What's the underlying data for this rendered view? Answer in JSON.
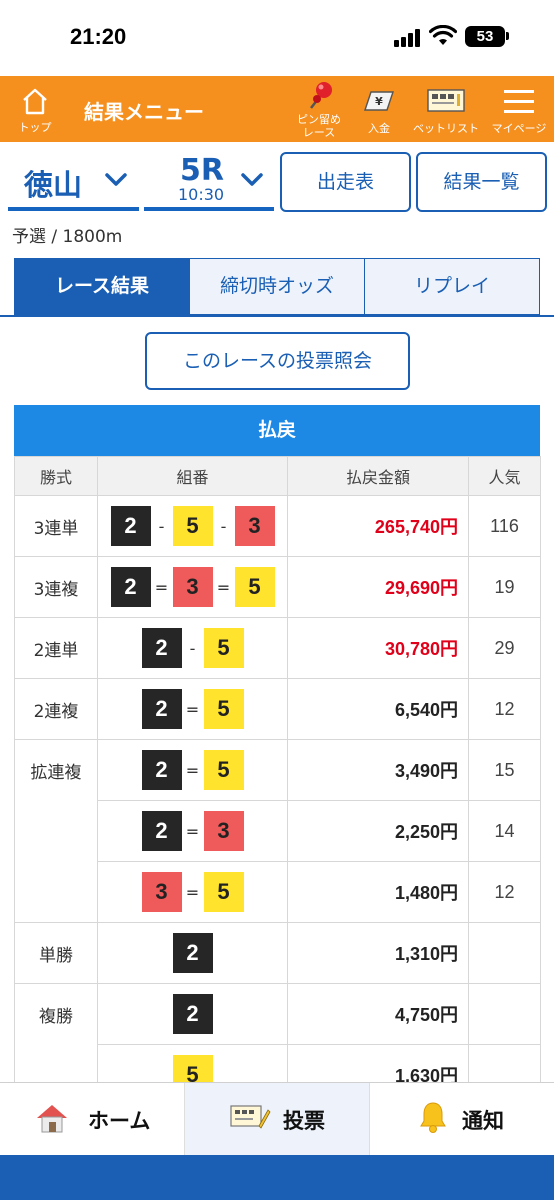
{
  "status_bar": {
    "time": "21:20",
    "battery": "53"
  },
  "header": {
    "home_label": "トップ",
    "title": "結果メニュー",
    "pin_label_line1": "ピン留め",
    "pin_label_line2": "レース",
    "deposit_label": "入金",
    "pets_label": "ベットリスト",
    "mypage_label": "マイページ"
  },
  "race": {
    "venue": "徳山",
    "number": "5R",
    "time": "10:30",
    "grade": "予選 / 1800m",
    "entry_button": "出走表",
    "results_list_button": "結果一覧"
  },
  "tabs": [
    {
      "label": "レース結果",
      "active": true
    },
    {
      "label": "締切時オッズ",
      "active": false
    },
    {
      "label": "リプレイ",
      "active": false
    }
  ],
  "vote_inquiry_button": "このレースの投票照会",
  "payout": {
    "title": "払戻",
    "headers": {
      "type": "勝式",
      "combo": "組番",
      "amount": "払戻金額",
      "popularity": "人気"
    },
    "rows": [
      {
        "type": "3連単",
        "boats": [
          "2",
          "5",
          "3"
        ],
        "seps": [
          "-",
          "-"
        ],
        "amount": "265,740円",
        "popularity": "116",
        "highlight": true
      },
      {
        "type": "3連複",
        "boats": [
          "2",
          "3",
          "5"
        ],
        "seps": [
          "=",
          "="
        ],
        "amount": "29,690円",
        "popularity": "19",
        "highlight": true
      },
      {
        "type": "2連単",
        "boats": [
          "2",
          "5"
        ],
        "seps": [
          "-"
        ],
        "amount": "30,780円",
        "popularity": "29",
        "highlight": true
      },
      {
        "type": "2連複",
        "boats": [
          "2",
          "5"
        ],
        "seps": [
          "="
        ],
        "amount": "6,540円",
        "popularity": "12",
        "highlight": false
      },
      {
        "type": "拡連複",
        "boats": [
          "2",
          "5"
        ],
        "seps": [
          "="
        ],
        "amount": "3,490円",
        "popularity": "15",
        "highlight": false
      },
      {
        "type": "",
        "boats": [
          "2",
          "3"
        ],
        "seps": [
          "="
        ],
        "amount": "2,250円",
        "popularity": "14",
        "highlight": false
      },
      {
        "type": "",
        "boats": [
          "3",
          "5"
        ],
        "seps": [
          "="
        ],
        "amount": "1,480円",
        "popularity": "12",
        "highlight": false
      },
      {
        "type": "単勝",
        "boats": [
          "2"
        ],
        "seps": [],
        "amount": "1,310円",
        "popularity": "",
        "highlight": false
      },
      {
        "type": "複勝",
        "boats": [
          "2"
        ],
        "seps": [],
        "amount": "4,750円",
        "popularity": "",
        "highlight": false
      },
      {
        "type": "",
        "boats": [
          "5"
        ],
        "seps": [],
        "amount": "1,630円",
        "popularity": "",
        "highlight": false
      }
    ]
  },
  "colors": {
    "accent": "#1a5fb4",
    "header": "#f5901f",
    "payout_red": "#e0001a"
  },
  "bottom_nav": [
    {
      "label": "ホーム",
      "icon": "house-icon"
    },
    {
      "label": "投票",
      "icon": "betting-slip-icon",
      "active": true
    },
    {
      "label": "通知",
      "icon": "bell-icon"
    }
  ]
}
